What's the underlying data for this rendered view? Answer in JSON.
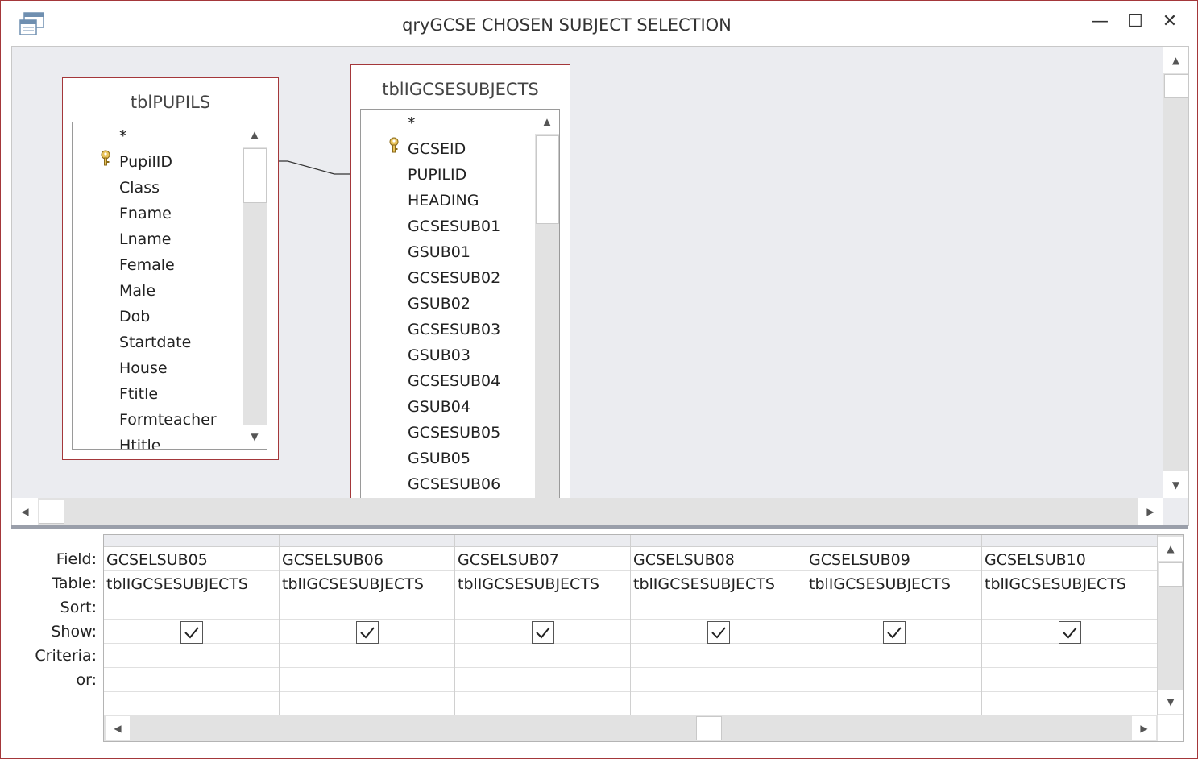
{
  "window": {
    "title": "qryGCSE CHOSEN SUBJECT SELECTION"
  },
  "controls": {
    "minimize": "—",
    "maximize": "☐",
    "close": "✕"
  },
  "tables": [
    {
      "name": "tblPUPILS",
      "fields": [
        "*",
        "PupilID",
        "Class",
        "Fname",
        "Lname",
        "Female",
        "Male",
        "Dob",
        "Startdate",
        "House",
        "Ftitle",
        "Formteacher",
        "Htitle"
      ],
      "key_field": "PupilID"
    },
    {
      "name": "tblIGCSESUBJECTS",
      "fields": [
        "*",
        "GCSEID",
        "PUPILID",
        "HEADING",
        "GCSESUB01",
        "GSUB01",
        "GCSESUB02",
        "GSUB02",
        "GCSESUB03",
        "GSUB03",
        "GCSESUB04",
        "GSUB04",
        "GCSESUB05",
        "GSUB05",
        "GCSESUB06"
      ],
      "key_field": "GCSEID"
    }
  ],
  "grid": {
    "row_labels": [
      "Field:",
      "Table:",
      "Sort:",
      "Show:",
      "Criteria:",
      "or:"
    ],
    "columns": [
      {
        "field": "GCSELSUB05",
        "table": "tblIGCSESUBJECTS",
        "show": true
      },
      {
        "field": "GCSELSUB06",
        "table": "tblIGCSESUBJECTS",
        "show": true
      },
      {
        "field": "GCSELSUB07",
        "table": "tblIGCSESUBJECTS",
        "show": true
      },
      {
        "field": "GCSELSUB08",
        "table": "tblIGCSESUBJECTS",
        "show": true
      },
      {
        "field": "GCSELSUB09",
        "table": "tblIGCSESUBJECTS",
        "show": true
      },
      {
        "field": "GCSELSUB10",
        "table": "tblIGCSESUBJECTS",
        "show": true
      }
    ]
  },
  "colors": {
    "border_accent": "#a4373a",
    "design_bg": "#ebecf0"
  }
}
